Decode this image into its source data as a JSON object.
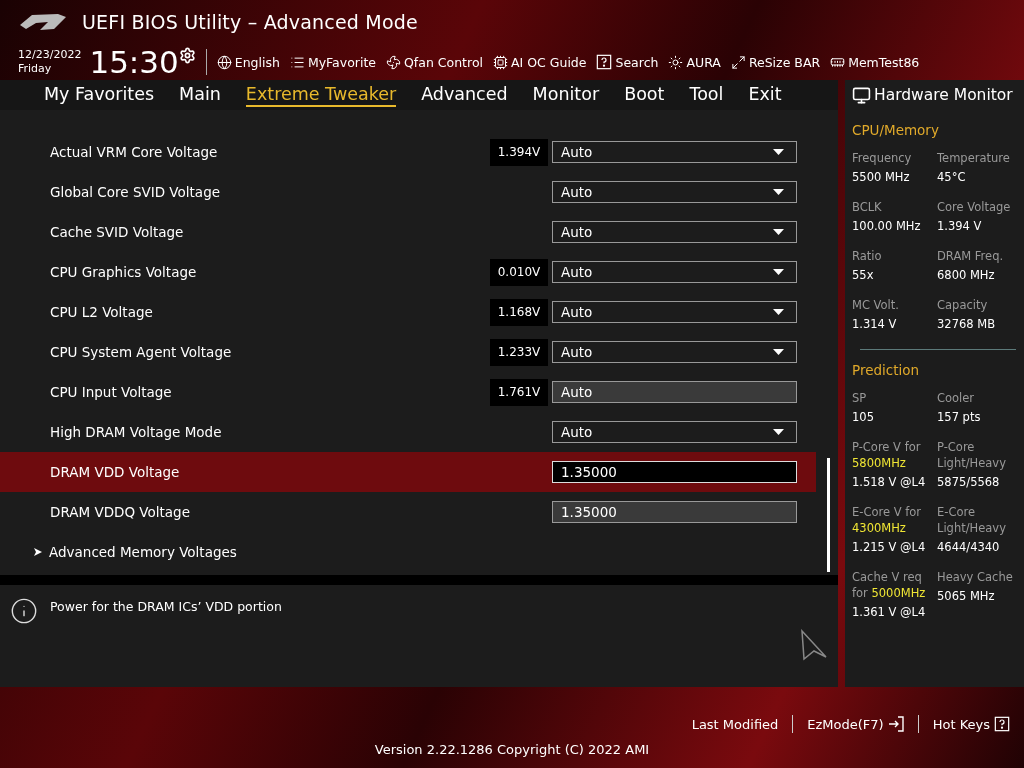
{
  "header": {
    "title": "UEFI BIOS Utility – Advanced Mode",
    "date": "12/23/2022",
    "day": "Friday",
    "time": "15:30",
    "toolbar": [
      {
        "kind": "globe",
        "label": "English"
      },
      {
        "kind": "list",
        "label": "MyFavorite"
      },
      {
        "kind": "fan",
        "label": "Qfan Control"
      },
      {
        "kind": "chip",
        "label": "AI OC Guide"
      },
      {
        "kind": "help",
        "label": "Search"
      },
      {
        "kind": "light",
        "label": "AURA"
      },
      {
        "kind": "resize",
        "label": "ReSize BAR"
      },
      {
        "kind": "memory",
        "label": "MemTest86"
      }
    ]
  },
  "tabs": [
    {
      "label": "My Favorites",
      "selected": false
    },
    {
      "label": "Main",
      "selected": false
    },
    {
      "label": "Extreme Tweaker",
      "selected": true
    },
    {
      "label": "Advanced",
      "selected": false
    },
    {
      "label": "Monitor",
      "selected": false
    },
    {
      "label": "Boot",
      "selected": false
    },
    {
      "label": "Tool",
      "selected": false
    },
    {
      "label": "Exit",
      "selected": false
    }
  ],
  "settings": [
    {
      "kind": "dropdown",
      "label": "Actual VRM Core Voltage",
      "reading": "1.394V",
      "value": "Auto",
      "selected": false
    },
    {
      "kind": "dropdown",
      "label": "Global Core SVID Voltage",
      "value": "Auto",
      "selected": false
    },
    {
      "kind": "dropdown",
      "label": "Cache SVID Voltage",
      "value": "Auto",
      "selected": false
    },
    {
      "kind": "dropdown",
      "label": "CPU Graphics Voltage",
      "reading": "0.010V",
      "value": "Auto",
      "selected": false
    },
    {
      "kind": "dropdown",
      "label": "CPU L2 Voltage",
      "reading": "1.168V",
      "value": "Auto",
      "selected": false
    },
    {
      "kind": "dropdown",
      "label": "CPU System Agent Voltage",
      "reading": "1.233V",
      "value": "Auto",
      "selected": false
    },
    {
      "kind": "readonly",
      "label": "CPU Input Voltage",
      "reading": "1.761V",
      "value": "Auto",
      "selected": false
    },
    {
      "kind": "dropdown",
      "label": "High DRAM Voltage Mode",
      "value": "Auto",
      "selected": false
    },
    {
      "kind": "input",
      "label": "DRAM VDD Voltage",
      "value": "1.35000",
      "selected": true
    },
    {
      "kind": "readonly",
      "label": "DRAM VDDQ Voltage",
      "value": "1.35000",
      "selected": false
    },
    {
      "kind": "submenu",
      "label": "Advanced Memory Voltages",
      "selected": false
    }
  ],
  "help": {
    "text": "Power for the DRAM ICs’ VDD portion"
  },
  "hardware_monitor": {
    "title": "Hardware Monitor",
    "sections": [
      {
        "title": "CPU/Memory",
        "items": [
          {
            "label": "Frequency",
            "value": "5500 MHz"
          },
          {
            "label": "Temperature",
            "value": "45°C"
          },
          {
            "label": "BCLK",
            "value": "100.00 MHz"
          },
          {
            "label": "Core Voltage",
            "value": "1.394 V"
          },
          {
            "label": "Ratio",
            "value": "55x"
          },
          {
            "label": "DRAM Freq.",
            "value": "6800 MHz"
          },
          {
            "label": "MC Volt.",
            "value": "1.314 V"
          },
          {
            "label": "Capacity",
            "value": "32768 MB"
          }
        ]
      },
      {
        "title": "Prediction",
        "items": [
          {
            "label": "SP",
            "value": "105"
          },
          {
            "label": "Cooler",
            "value": "157 pts"
          },
          {
            "label": "P-Core V for",
            "highlight": "5800MHz",
            "value": "1.518 V @L4"
          },
          {
            "label": "P-Core Light/Heavy",
            "value": "5875/5568"
          },
          {
            "label": "E-Core V for",
            "highlight": "4300MHz",
            "value": "1.215 V @L4"
          },
          {
            "label": "E-Core Light/Heavy",
            "value": "4644/4340"
          },
          {
            "label": "Cache V req for",
            "highlight": "5000MHz",
            "value": "1.361 V @L4"
          },
          {
            "label": "Heavy Cache",
            "value": "5065 MHz"
          }
        ]
      }
    ]
  },
  "footer": {
    "last_modified": "Last Modified",
    "ez_mode": "EzMode(F7)",
    "hot_keys": "Hot Keys",
    "version": "Version 2.22.1286 Copyright (C) 2022 AMI"
  }
}
